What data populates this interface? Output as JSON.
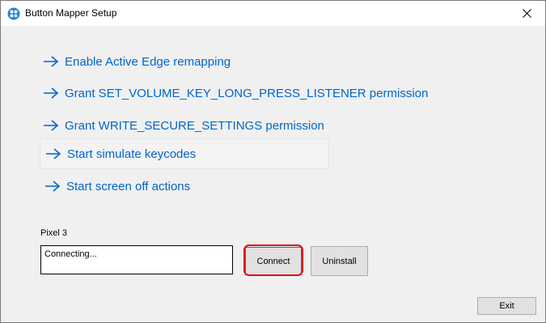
{
  "window": {
    "title": "Button Mapper Setup",
    "app_icon": "button-mapper-logo",
    "close_icon": "close-icon"
  },
  "actions": [
    {
      "label": "Enable Active Edge remapping"
    },
    {
      "label": "Grant SET_VOLUME_KEY_LONG_PRESS_LISTENER permission"
    },
    {
      "label": "Grant WRITE_SECURE_SETTINGS permission"
    },
    {
      "label": "Start simulate keycodes"
    },
    {
      "label": "Start screen off actions"
    }
  ],
  "device": {
    "name": "Pixel 3",
    "status": "Connecting..."
  },
  "buttons": {
    "connect": "Connect",
    "uninstall": "Uninstall",
    "exit": "Exit"
  },
  "colors": {
    "link": "#0066cc",
    "highlight": "#e01010",
    "focus": "#0078d7"
  }
}
